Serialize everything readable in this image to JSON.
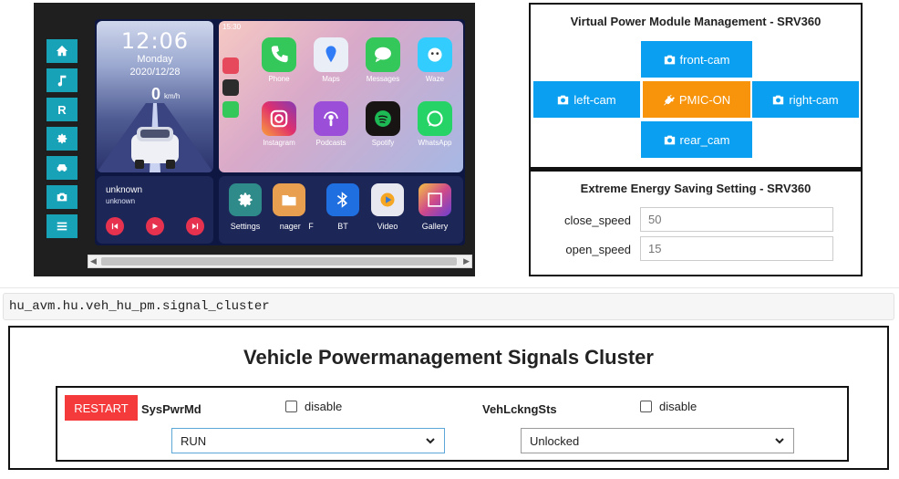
{
  "head_unit": {
    "side_nav": [
      {
        "name": "home-icon"
      },
      {
        "name": "music-icon"
      },
      {
        "name": "radio-label",
        "label": "R"
      },
      {
        "name": "gear-icon"
      },
      {
        "name": "car-icon"
      },
      {
        "name": "camera-icon"
      },
      {
        "name": "menu-icon"
      }
    ],
    "clock": {
      "time": "12:06",
      "day": "Monday",
      "date": "2020/12/28",
      "speed": "0",
      "speed_unit": "km/h"
    },
    "status_time": "15:30",
    "apps": [
      {
        "label": "Phone",
        "color": "#34c759"
      },
      {
        "label": "Maps",
        "color": "#e9eef7"
      },
      {
        "label": "Messages",
        "color": "#34c759"
      },
      {
        "label": "Waze",
        "color": "#33ccff"
      },
      {
        "label": "Instagram",
        "color": "#e1306c"
      },
      {
        "label": "Podcasts",
        "color": "#9b4fd9"
      },
      {
        "label": "Spotify",
        "color": "#191414"
      },
      {
        "label": "WhatsApp",
        "color": "#25d366"
      }
    ],
    "media": {
      "title": "unknown",
      "artist": "unknown"
    },
    "dock": [
      {
        "label": "Settings",
        "color": "#2f8a8a"
      },
      {
        "label": " nager",
        "color": "#e8a050"
      },
      {
        "label": "F",
        "color": "#1c2657"
      },
      {
        "label": "BT",
        "color": "#1f6fe0"
      },
      {
        "label": "Video",
        "color": "#e8e8f0"
      },
      {
        "label": "Gallery",
        "color": "#d04a8a"
      }
    ]
  },
  "vpm": {
    "title": "Virtual Power Module Management - SRV360",
    "front": "front-cam",
    "left": "left-cam",
    "pmic": "PMIC-ON",
    "right": "right-cam",
    "rear": "rear_cam"
  },
  "energy": {
    "title": "Extreme Energy Saving Setting - SRV360",
    "close_label": "close_speed",
    "close_value": "50",
    "open_label": "open_speed",
    "open_value": "15"
  },
  "signal_path": "hu_avm.hu.veh_hu_pm.signal_cluster",
  "cluster": {
    "title": "Vehicle Powermanagement Signals Cluster",
    "restart": "RESTART",
    "sys_name": "SysPwrMd",
    "sys_disable": "disable",
    "sys_value": "RUN",
    "veh_name": "VehLckngSts",
    "veh_disable": "disable",
    "veh_value": "Unlocked"
  },
  "colors": {
    "teal": "#17a2b8",
    "cam_blue": "#0a9ff0",
    "pmic_orange": "#f7940c",
    "restart_red": "#f43a3a"
  }
}
